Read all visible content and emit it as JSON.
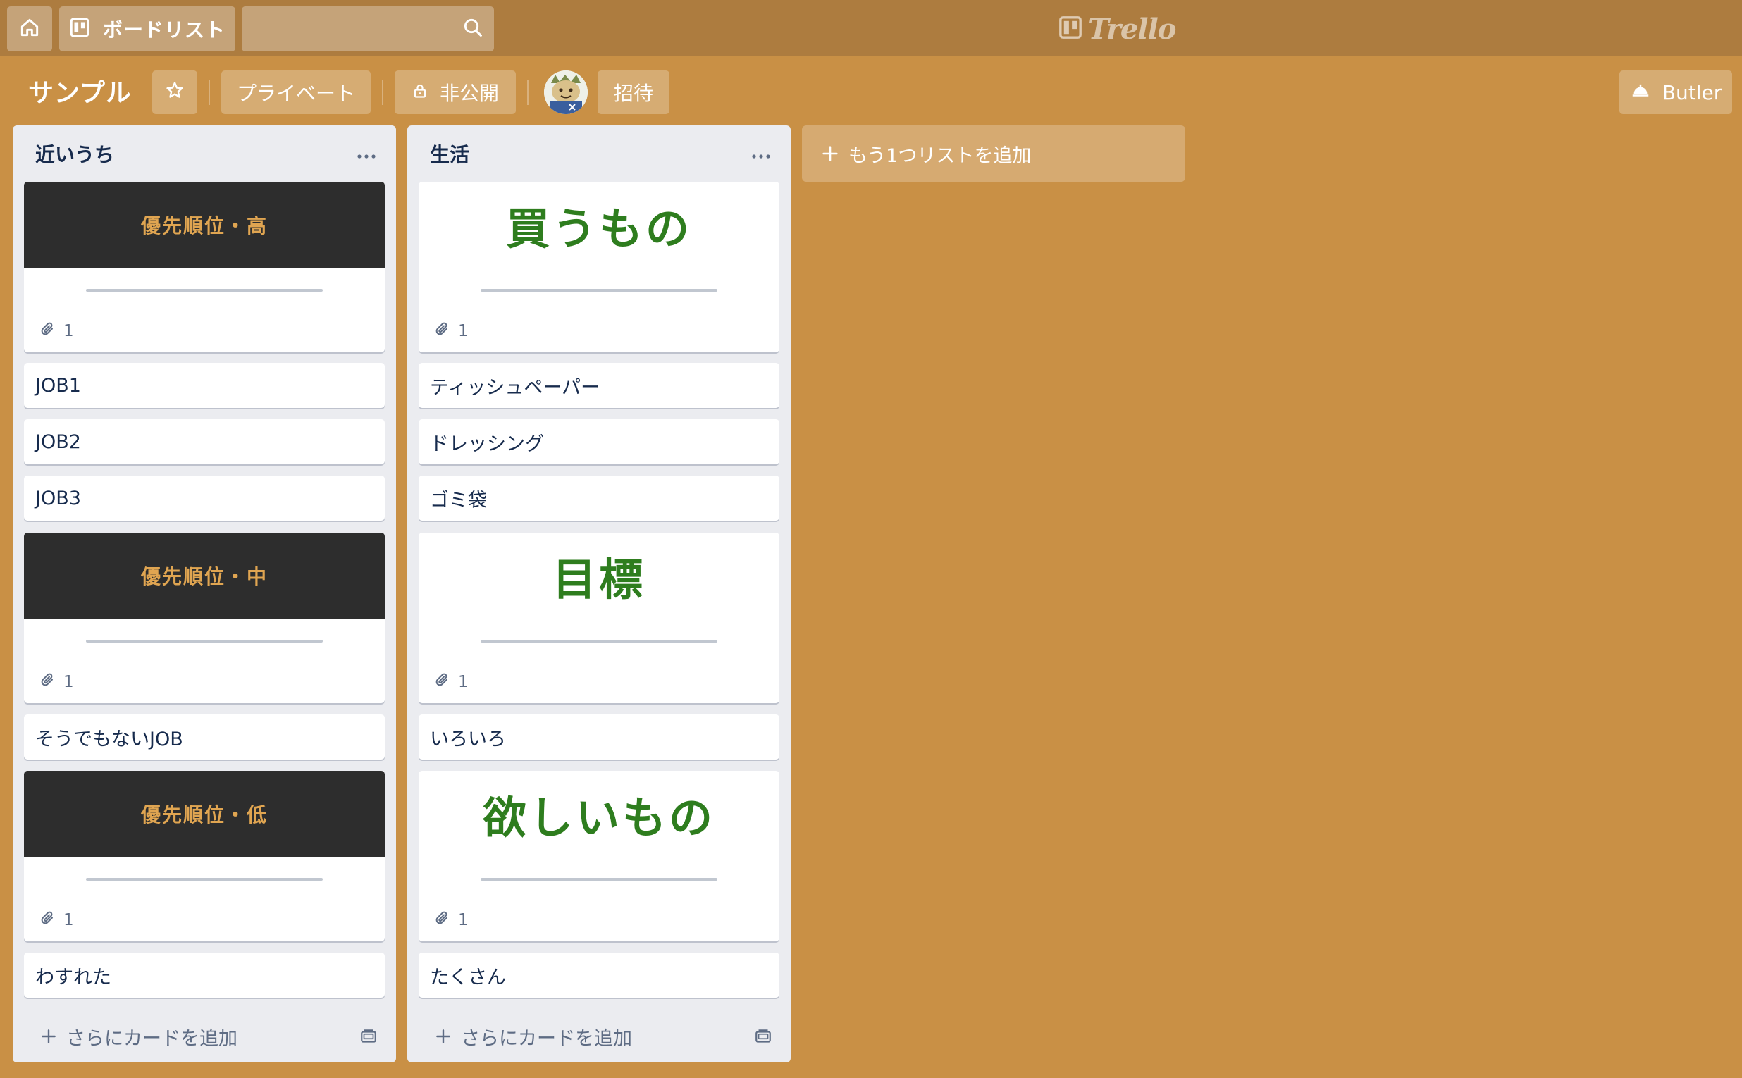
{
  "header": {
    "boards_label": "ボードリスト",
    "search_value": "",
    "logo_text": "Trello"
  },
  "board": {
    "title": "サンプル",
    "privacy_label": "プライベート",
    "visibility_label": "非公開",
    "invite_label": "招待",
    "butler_label": "Butler"
  },
  "lists": [
    {
      "title": "近いうち",
      "add_card_label": "さらにカードを追加",
      "cards": [
        {
          "type": "cover",
          "cover_text": "優先順位・高",
          "attachments": "1"
        },
        {
          "type": "text",
          "text": "JOB1"
        },
        {
          "type": "text",
          "text": "JOB2"
        },
        {
          "type": "text",
          "text": "JOB3"
        },
        {
          "type": "cover",
          "cover_text": "優先順位・中",
          "attachments": "1"
        },
        {
          "type": "text",
          "text": "そうでもないJOB"
        },
        {
          "type": "cover",
          "cover_text": "優先順位・低",
          "attachments": "1"
        },
        {
          "type": "text",
          "text": "わすれた"
        }
      ]
    },
    {
      "title": "生活",
      "add_card_label": "さらにカードを追加",
      "cards": [
        {
          "type": "cover",
          "cover_text": "買うもの",
          "attachments": "1"
        },
        {
          "type": "text",
          "text": "ティッシュペーパー"
        },
        {
          "type": "text",
          "text": "ドレッシング"
        },
        {
          "type": "text",
          "text": "ゴミ袋"
        },
        {
          "type": "cover",
          "cover_text": "目標",
          "attachments": "1"
        },
        {
          "type": "text",
          "text": "いろいろ"
        },
        {
          "type": "cover",
          "cover_text": "欲しいもの",
          "attachments": "1"
        },
        {
          "type": "text",
          "text": "たくさん"
        }
      ]
    }
  ],
  "add_list_label": "もう1つリストを追加",
  "colors": {
    "board_bg": "#c99045",
    "header_bg": "#ad7c3f",
    "priority_text": "#e0a551",
    "category_text": "#2e7d1e"
  }
}
